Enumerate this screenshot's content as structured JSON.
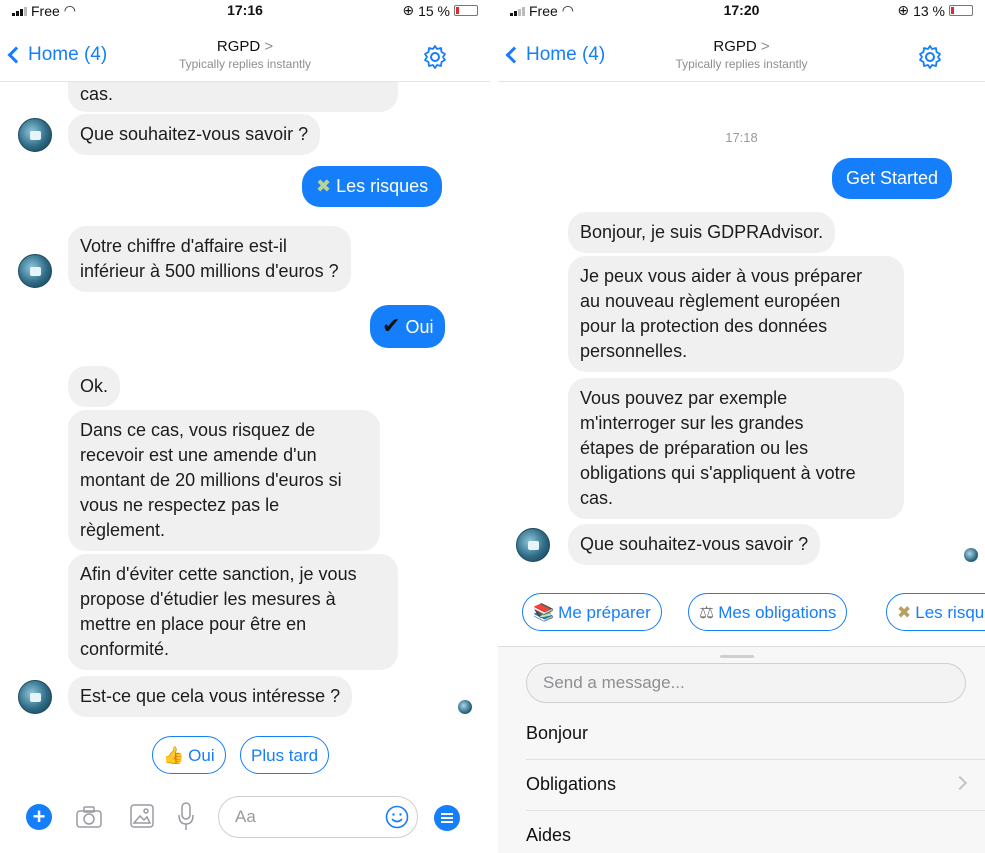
{
  "colors": {
    "accent": "#157efb",
    "bubble": "#f1f0f0",
    "battery_low": "#e3262f"
  },
  "left": {
    "status": {
      "carrier": "Free",
      "time": "17:16",
      "battery": "15 %"
    },
    "nav": {
      "back": "Home (4)",
      "title": "RGPD",
      "subtitle": "Typically replies instantly",
      "title_chevron": ">"
    },
    "messages": {
      "m0": "cas.",
      "m1": "Que souhaitez-vous savoir ?",
      "out1": "Les risques",
      "m2": "Votre chiffre d'affaire est-il\ninférieur à 500 millions d'euros ?",
      "out2": "Oui",
      "m3": "Ok.",
      "m4": "Dans ce cas, vous risquez de\nrecevoir est une amende d'un\nmontant de 20 millions d'euros si\nvous ne respectez pas le\nrèglement.",
      "m5": "Afin d'éviter cette sanction, je vous\npropose d'étudier les mesures à\nmettre en place pour être en\nconformité.",
      "m6": "Est-ce que cela vous intéresse ?"
    },
    "out_icons": {
      "out1": "money-with-wings-emoji",
      "out2": "checkmark"
    },
    "checkmark": "✔",
    "quick_replies": [
      {
        "label": "Oui",
        "icon": "thumbs-up-emoji"
      },
      {
        "label": "Plus tard"
      }
    ],
    "composer": {
      "placeholder": "Aa",
      "icons": [
        "plus-icon",
        "camera-icon",
        "gallery-icon",
        "microphone-icon",
        "emoji-icon",
        "menu-icon"
      ]
    }
  },
  "right": {
    "status": {
      "carrier": "Free",
      "time": "17:20",
      "battery": "13 %"
    },
    "nav": {
      "back": "Home (4)",
      "title": "RGPD",
      "subtitle": "Typically replies instantly",
      "title_chevron": ">"
    },
    "timestamp": "17:18",
    "messages": {
      "out1": "Get Started",
      "m1": "Bonjour, je suis GDPRAdvisor.",
      "m2": "Je peux vous aider à vous préparer\nau nouveau règlement européen\npour la protection des données\npersonnelles.",
      "m3": "Vous pouvez par exemple\nm'interroger sur les grandes\nétapes de préparation ou les\nobligations qui s'appliquent à votre\ncas.",
      "m4": "Que souhaitez-vous savoir ?"
    },
    "quick_replies": [
      {
        "label": "Me préparer",
        "icon": "books-emoji"
      },
      {
        "label": "Mes obligations",
        "icon": "scales-emoji"
      },
      {
        "label": "Les risques",
        "icon": "money-with-wings-emoji"
      }
    ],
    "send_placeholder": "Send a message...",
    "menu": [
      "Bonjour",
      "Obligations",
      "Aides"
    ]
  }
}
